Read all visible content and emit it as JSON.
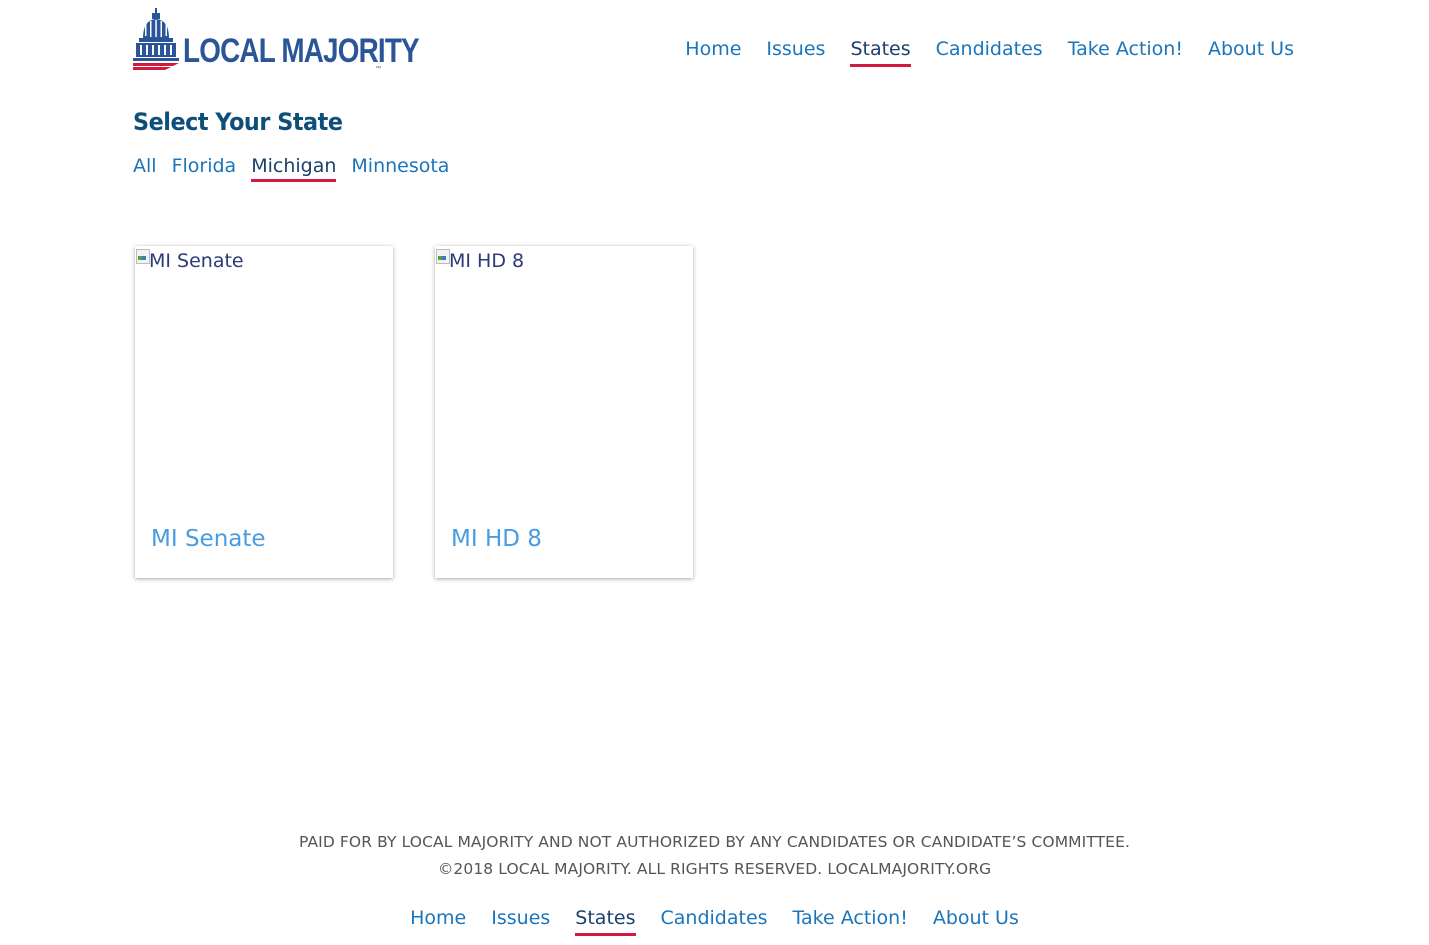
{
  "header": {
    "logo_text": "LOCAL MAJORITY",
    "logo_tm": "™",
    "nav": [
      {
        "label": "Home",
        "active": false
      },
      {
        "label": "Issues",
        "active": false
      },
      {
        "label": "States",
        "active": true
      },
      {
        "label": "Candidates",
        "active": false
      },
      {
        "label": "Take Action!",
        "active": false
      },
      {
        "label": "About Us",
        "active": false
      }
    ]
  },
  "main": {
    "title": "Select Your State",
    "filters": [
      {
        "label": "All",
        "active": false
      },
      {
        "label": "Florida",
        "active": false
      },
      {
        "label": "Michigan",
        "active": true
      },
      {
        "label": "Minnesota",
        "active": false
      }
    ],
    "cards": [
      {
        "image_alt": "MI Senate",
        "title": "MI Senate"
      },
      {
        "image_alt": "MI HD 8",
        "title": "MI HD 8"
      }
    ]
  },
  "footer": {
    "disclaimer": "PAID FOR BY LOCAL MAJORITY AND NOT AUTHORIZED BY ANY CANDIDATES OR CANDIDATE’S COMMITTEE.",
    "copyright": "©2018 LOCAL MAJORITY. ALL RIGHTS RESERVED. LOCALMAJORITY.ORG",
    "nav": [
      {
        "label": "Home",
        "active": false
      },
      {
        "label": "Issues",
        "active": false
      },
      {
        "label": "States",
        "active": true
      },
      {
        "label": "Candidates",
        "active": false
      },
      {
        "label": "Take Action!",
        "active": false
      },
      {
        "label": "About Us",
        "active": false
      }
    ]
  },
  "colors": {
    "link": "#1b75bb",
    "active_underline": "#d11a3d",
    "title": "#0d4f7a",
    "card_title": "#4a9ce0",
    "logo_blue": "#2a5699",
    "logo_red": "#d11a3d"
  }
}
